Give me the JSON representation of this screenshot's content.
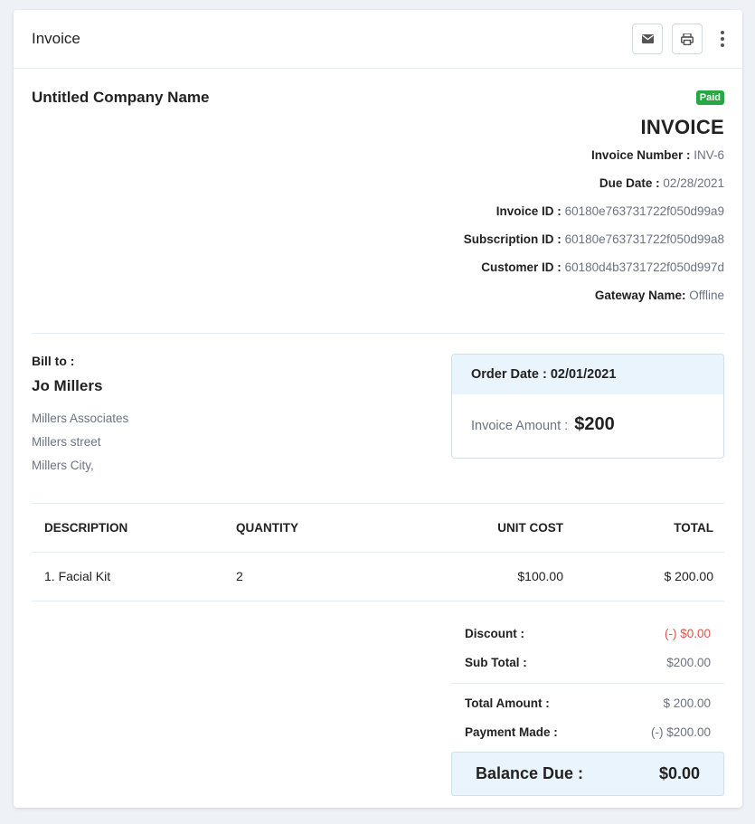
{
  "header": {
    "title": "Invoice"
  },
  "company": {
    "name": "Untitled Company Name"
  },
  "status": {
    "badge": "Paid",
    "badge_color": "#28a745"
  },
  "invoice": {
    "title": "INVOICE",
    "meta": [
      {
        "label": "Invoice Number :",
        "value": "INV-6"
      },
      {
        "label": "Due Date :",
        "value": "02/28/2021"
      },
      {
        "label": "Invoice ID :",
        "value": "60180e763731722f050d99a9"
      },
      {
        "label": "Subscription ID :",
        "value": "60180e763731722f050d99a8"
      },
      {
        "label": "Customer ID :",
        "value": "60180d4b3731722f050d997d"
      },
      {
        "label": "Gateway Name:",
        "value": "Offline"
      }
    ]
  },
  "bill_to": {
    "label": "Bill to :",
    "name": "Jo Millers",
    "lines": [
      "Millers Associates",
      "Millers street",
      "Millers City,"
    ]
  },
  "order": {
    "date_label": "Order Date : 02/01/2021",
    "amount_label": "Invoice Amount :",
    "amount_value": "$200"
  },
  "table": {
    "headers": [
      "DESCRIPTION",
      "QUANTITY",
      "UNIT COST",
      "TOTAL"
    ],
    "rows": [
      {
        "description": "1. Facial Kit",
        "quantity": "2",
        "unit_cost": "$100.00",
        "total": "$ 200.00"
      }
    ]
  },
  "totals": {
    "discount_label": "Discount :",
    "discount_value": "(-) $0.00",
    "subtotal_label": "Sub Total :",
    "subtotal_value": "$200.00",
    "total_label": "Total Amount :",
    "total_value": "$ 200.00",
    "paid_label": "Payment Made :",
    "paid_value": "(-) $200.00",
    "balance_label": "Balance Due :",
    "balance_value": "$0.00"
  },
  "icons": {
    "email": "envelope-icon",
    "print": "printer-icon",
    "more": "more-vertical-icon"
  }
}
